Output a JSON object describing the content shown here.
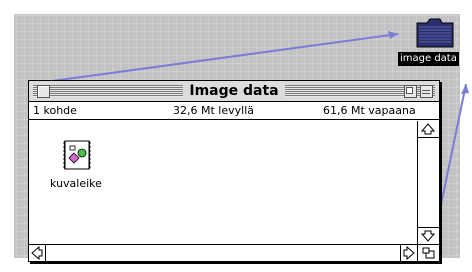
{
  "desktop": {
    "icon_label": "image data"
  },
  "window": {
    "title": "Image data",
    "info": {
      "items": "1 kohde",
      "used": "32,6 Mt levyllä",
      "free": "61,6 Mt vapaana"
    },
    "files": [
      {
        "name": "kuvaleike"
      }
    ]
  },
  "colors": {
    "desktop": "#c3c3c3",
    "zoom_lines": "#7a7fd6",
    "folder": "#2b2f6e",
    "file_diamond": "#d966d0",
    "file_circle": "#49c24a"
  }
}
